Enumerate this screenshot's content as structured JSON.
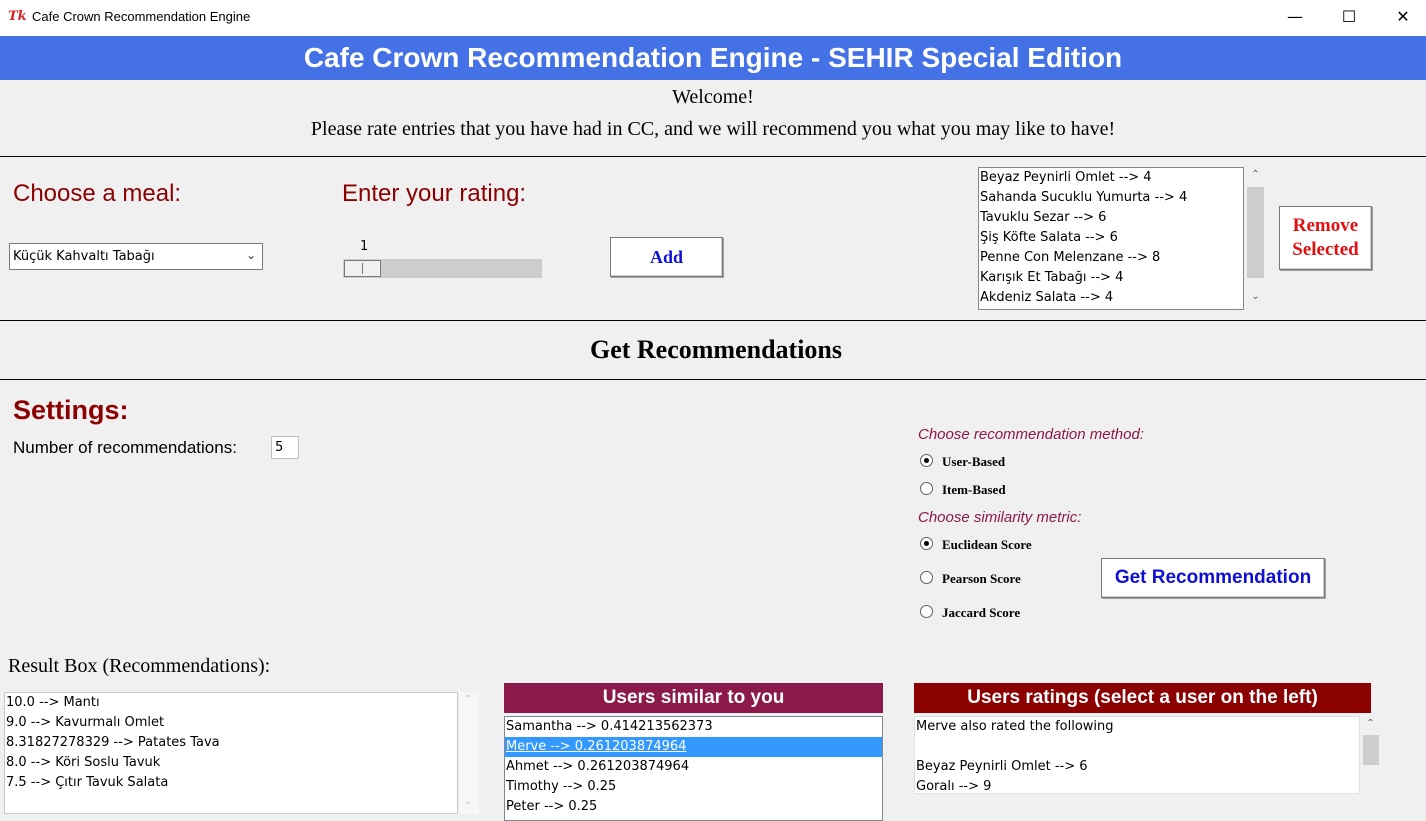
{
  "window": {
    "title": "Cafe Crown Recommendation Engine",
    "logo": "Tk",
    "minimize": "—",
    "maximize": "☐",
    "close": "✕"
  },
  "banner": {
    "title": "Cafe Crown Recommendation Engine - SEHIR Special Edition",
    "bg_color": "#4472e6"
  },
  "welcome": {
    "line1": "Welcome!",
    "line2": "Please rate entries that you have had in CC, and we will recommend you what you may like to have!"
  },
  "rating_section": {
    "meal_label": "Choose a meal:",
    "meal_selected": "Küçük Kahvaltı Tabağı",
    "rating_label": "Enter your rating:",
    "rating_value": "1",
    "rating_fraction": 0.0,
    "add_label": "Add",
    "rated_items": [
      "Beyaz Peynirli Omlet --> 4",
      "Sahanda Sucuklu Yumurta --> 4",
      "Tavuklu Sezar --> 6",
      "Şiş Köfte Salata --> 6",
      "Penne Con Melenzane --> 8",
      "Karışık Et Tabağı --> 4",
      "Akdeniz Salata --> 4"
    ],
    "remove_label_line1": "Remove",
    "remove_label_line2": "Selected"
  },
  "get_recommendations": {
    "heading": "Get Recommendations"
  },
  "settings": {
    "heading": "Settings:",
    "num_label": "Number of recommendations:",
    "num_value": "5",
    "method_label": "Choose recommendation method:",
    "methods": [
      {
        "label": "User-Based",
        "selected": true
      },
      {
        "label": "Item-Based",
        "selected": false
      }
    ],
    "metric_label": "Choose similarity metric:",
    "metrics": [
      {
        "label": "Euclidean Score",
        "selected": true
      },
      {
        "label": "Pearson Score",
        "selected": false
      },
      {
        "label": "Jaccard Score",
        "selected": false
      }
    ],
    "get_button_label": "Get Recommendation"
  },
  "results": {
    "label": "Result Box (Recommendations):",
    "items": [
      "10.0 --> Mantı",
      "9.0 --> Kavurmalı Omlet",
      "8.31827278329 --> Patates Tava",
      "8.0 --> Köri Soslu Tavuk",
      "7.5 --> Çıtır Tavuk Salata"
    ]
  },
  "similar_users": {
    "heading": "Users similar to you",
    "head_color": "#8b1a4a",
    "items": [
      "Samantha --> 0.414213562373",
      "Merve --> 0.261203874964",
      "Ahmet --> 0.261203874964",
      "Timothy --> 0.25",
      "Peter --> 0.25"
    ],
    "selected_index": 1
  },
  "user_ratings": {
    "heading": "Users ratings (select a user on the left)",
    "head_color": "#8b0000",
    "lines": [
      "Merve also rated the following",
      "",
      "Beyaz Peynirli Omlet --> 6",
      "Goralı --> 9"
    ]
  },
  "icons": {
    "scroll_up": "chevron-up-icon",
    "scroll_down": "chevron-down-icon",
    "combo_arrow": "chevron-down-icon"
  }
}
